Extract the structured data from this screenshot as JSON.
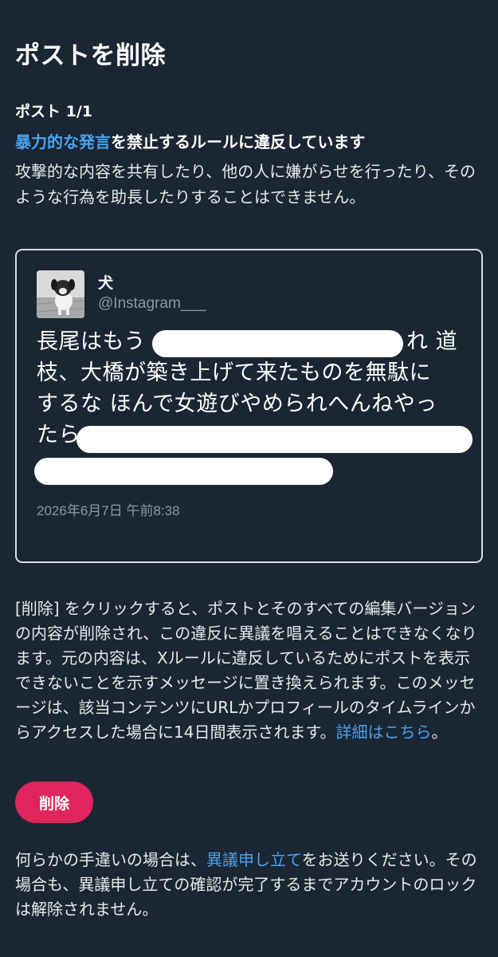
{
  "page": {
    "title": "ポストを削除"
  },
  "post": {
    "count_label": "ポスト 1/1",
    "rule_link": "暴力的な発言",
    "rule_rest": "を禁止するルールに違反しています",
    "rule_description": "攻撃的な内容を共有したり、他の人に嫌がらせを行ったり、そのような行為を助長したりすることはできません。"
  },
  "tweet": {
    "display_name": "犬",
    "handle": "@Instagram___",
    "line1_visible_start": "長尾はもう",
    "line1_visible_end": "れ 道",
    "line2": "枝、大橋が築き上げて来たものを無駄に",
    "line3": "するな ほんで女遊びやめられへんねやっ",
    "line4_visible": "たら",
    "timestamp": "2026年6月7日 午前8:38",
    "avatar_icon": "dog-avatar-icon"
  },
  "explanation": {
    "text": "[削除] をクリックすると、ポストとそのすべての編集バージョンの内容が削除され、この違反に異議を唱えることはできなくなります。元の内容は、Xルールに違反しているためにポストを表示できないことを示すメッセージに置き換えられます。このメッセージは、該当コンテンツにURLかプロフィールのタイムラインからアクセスした場合に14日間表示されます。",
    "link": "詳細はこちら",
    "suffix": "。"
  },
  "actions": {
    "delete_label": "削除"
  },
  "footer": {
    "prefix": "何らかの手違いの場合は、",
    "link": "異議申し立て",
    "suffix": "をお送りください。その場合も、異議申し立ての確認が完了するまでアカウントのロックは解除されません。"
  },
  "colors": {
    "background": "#1a2634",
    "link": "#4aa3ee",
    "danger": "#e0245e"
  }
}
